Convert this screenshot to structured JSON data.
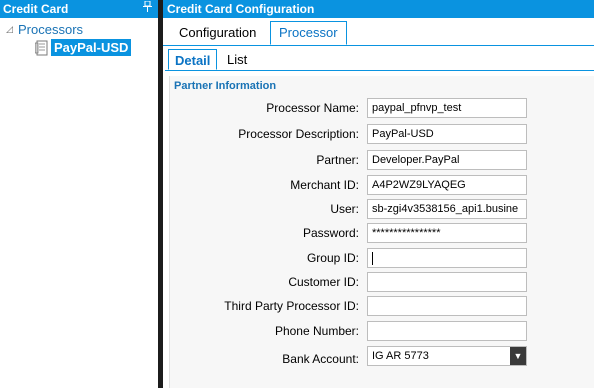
{
  "left_pane": {
    "title": "Credit Card",
    "pin_icon": "pin-icon",
    "tree": {
      "root_label": "Processors",
      "child_label": "PayPal-USD"
    }
  },
  "right_pane": {
    "title": "Credit Card Configuration",
    "tabs": [
      {
        "label": "Configuration",
        "active": false
      },
      {
        "label": "Processor",
        "active": true
      }
    ],
    "subtabs": [
      {
        "label": "Detail",
        "active": true
      },
      {
        "label": "List",
        "active": false
      }
    ],
    "section_title": "Partner Information",
    "fields": [
      {
        "label": "Processor Name:",
        "value": "paypal_pfnvp_test"
      },
      {
        "label": "Processor Description:",
        "value": "PayPal-USD"
      },
      {
        "label": "Partner:",
        "value": "Developer.PayPal"
      },
      {
        "label": "Merchant ID:",
        "value": "A4P2WZ9LYAQEG"
      },
      {
        "label": "User:",
        "value": "sb-zgi4v3538156_api1.busine"
      },
      {
        "label": "Password:",
        "value": "****************"
      },
      {
        "label": "Group ID:",
        "value": ""
      },
      {
        "label": "Customer ID:",
        "value": ""
      },
      {
        "label": "Third Party Processor ID:",
        "value": ""
      },
      {
        "label": "Phone Number:",
        "value": ""
      },
      {
        "label": "Bank Account:",
        "value": "IG AR 5773"
      }
    ]
  },
  "colors": {
    "accent": "#0a93e0",
    "link": "#1a73b5",
    "splitter": "#1c1c1c"
  }
}
